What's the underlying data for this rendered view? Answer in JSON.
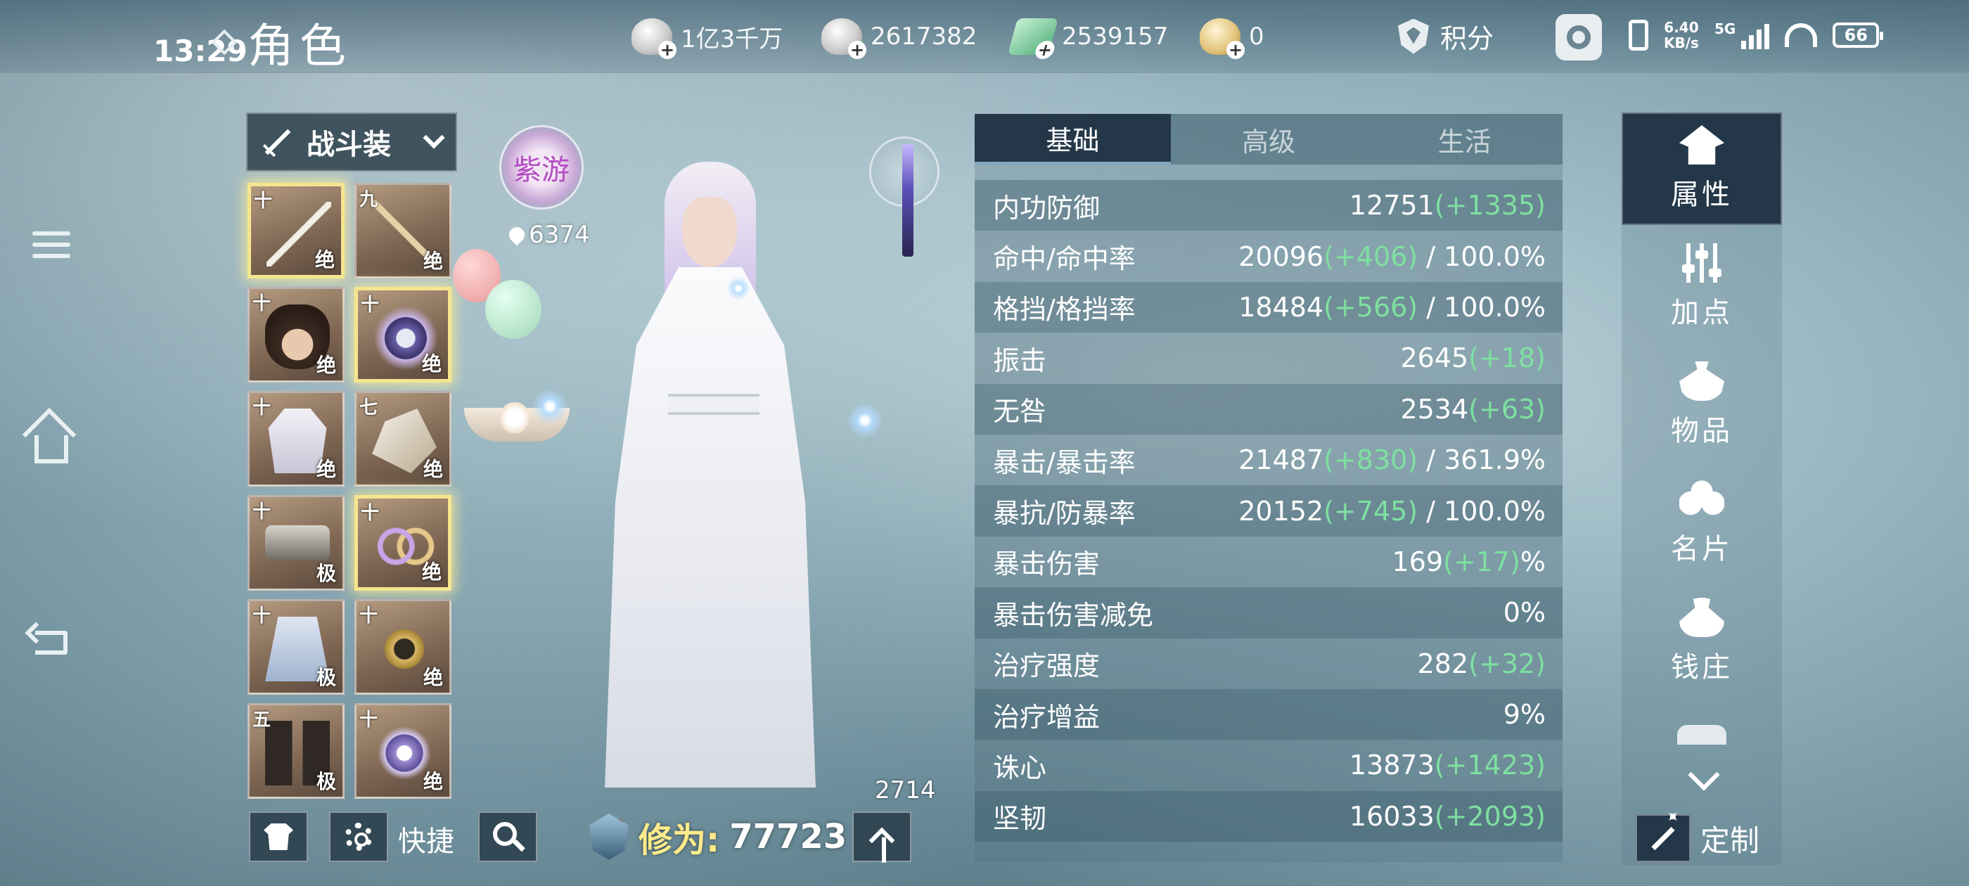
{
  "status_bar": {
    "time": "13:29",
    "net_speed_value": "6.40",
    "net_speed_unit": "KB/s",
    "net_type": "5G",
    "battery": "66"
  },
  "header": {
    "title": "角色",
    "currencies": [
      {
        "icon": "coin-stack-icon",
        "value": "1亿3千万"
      },
      {
        "icon": "silver-ingot-icon",
        "value": "2617382"
      },
      {
        "icon": "jade-ticket-icon",
        "value": "2539157"
      },
      {
        "icon": "gold-ingot-icon",
        "value": "0"
      }
    ],
    "points_label": "积分"
  },
  "equipment": {
    "outfit_label": "战斗装",
    "slots": [
      {
        "level": "十",
        "grade": "绝",
        "art": "weapon",
        "glow": true
      },
      {
        "level": "九",
        "grade": "绝",
        "art": "spear",
        "glow": false
      },
      {
        "level": "十",
        "grade": "绝",
        "art": "head",
        "glow": false
      },
      {
        "level": "十",
        "grade": "绝",
        "art": "amulet",
        "glow": true
      },
      {
        "level": "十",
        "grade": "绝",
        "art": "robe",
        "glow": false
      },
      {
        "level": "七",
        "grade": "绝",
        "art": "bracer",
        "glow": false
      },
      {
        "level": "十",
        "grade": "极",
        "art": "belt",
        "glow": false
      },
      {
        "level": "十",
        "grade": "绝",
        "art": "rings",
        "glow": true
      },
      {
        "level": "十",
        "grade": "极",
        "art": "cape",
        "glow": false
      },
      {
        "level": "十",
        "grade": "绝",
        "art": "ring",
        "glow": false
      },
      {
        "level": "五",
        "grade": "极",
        "art": "boots",
        "glow": false
      },
      {
        "level": "十",
        "grade": "绝",
        "art": "charm",
        "glow": false
      }
    ],
    "quick_label": "快捷"
  },
  "character": {
    "emblem_text": "紫游",
    "emblem_value": "6374",
    "cultivation_label": "修为:",
    "cultivation_value": "77723",
    "pet_value": "2714"
  },
  "stats": {
    "tabs": [
      "基础",
      "高级",
      "生活"
    ],
    "active_tab": 0,
    "rows": [
      {
        "name": "内功防御",
        "base": "12751",
        "bonus": "(+1335)",
        "suffix": ""
      },
      {
        "name": "命中/命中率",
        "base": "20096",
        "bonus": "(+406)",
        "suffix": " / 100.0%"
      },
      {
        "name": "格挡/格挡率",
        "base": "18484",
        "bonus": "(+566)",
        "suffix": " / 100.0%"
      },
      {
        "name": "振击",
        "base": "2645",
        "bonus": "(+18)",
        "suffix": ""
      },
      {
        "name": "无咎",
        "base": "2534",
        "bonus": "(+63)",
        "suffix": ""
      },
      {
        "name": "暴击/暴击率",
        "base": "21487",
        "bonus": "(+830)",
        "suffix": " / 361.9%"
      },
      {
        "name": "暴抗/防暴率",
        "base": "20152",
        "bonus": "(+745)",
        "suffix": " / 100.0%"
      },
      {
        "name": "暴击伤害",
        "base": "169",
        "bonus": "(+17)",
        "suffix": "%"
      },
      {
        "name": "暴击伤害减免",
        "base": "0%",
        "bonus": "",
        "suffix": ""
      },
      {
        "name": "治疗强度",
        "base": "282",
        "bonus": "(+32)",
        "suffix": ""
      },
      {
        "name": "治疗增益",
        "base": "9%",
        "bonus": "",
        "suffix": ""
      },
      {
        "name": "诛心",
        "base": "13873",
        "bonus": "(+1423)",
        "suffix": ""
      },
      {
        "name": "坚韧",
        "base": "16033",
        "bonus": "(+2093)",
        "suffix": ""
      }
    ]
  },
  "side_menu": {
    "items": [
      {
        "label": "属性",
        "icon": "hat-icon",
        "active": true
      },
      {
        "label": "加点",
        "icon": "sliders-icon",
        "active": false
      },
      {
        "label": "物品",
        "icon": "bag-icon",
        "active": false
      },
      {
        "label": "名片",
        "icon": "flower-icon",
        "active": false
      },
      {
        "label": "钱庄",
        "icon": "coin-bag-icon",
        "active": false
      }
    ],
    "custom_label": "定制"
  },
  "colors": {
    "bonus_green": "#7ee0a0",
    "active_tab_bg": "#233748",
    "cultivation_gold": "#ffeb8a",
    "slot_glow": "#f6e58f"
  }
}
